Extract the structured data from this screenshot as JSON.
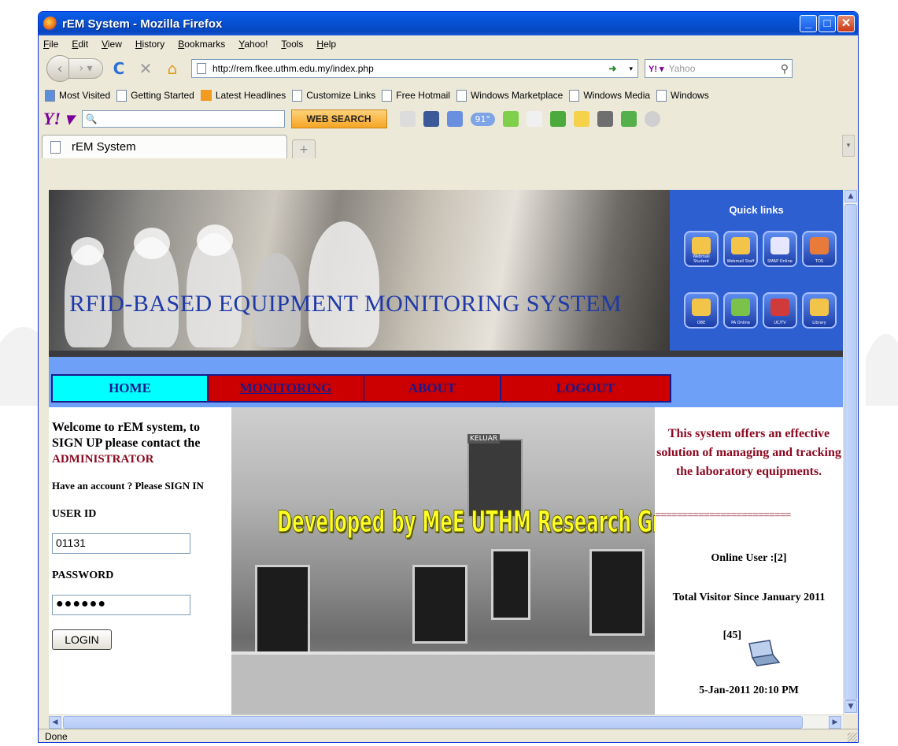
{
  "window": {
    "title": "rEM System - Mozilla Firefox"
  },
  "menubar": [
    "File",
    "Edit",
    "View",
    "History",
    "Bookmarks",
    "Yahoo!",
    "Tools",
    "Help"
  ],
  "navigation": {
    "url": "http://rem.fkee.uthm.edu.my/index.php",
    "search_placeholder": "Yahoo"
  },
  "bookmarks": [
    {
      "label": "Most Visited",
      "icon": "most-visited-icon"
    },
    {
      "label": "Getting Started",
      "icon": "page-icon"
    },
    {
      "label": "Latest Headlines",
      "icon": "rss-icon"
    },
    {
      "label": "Customize Links",
      "icon": "page-icon"
    },
    {
      "label": "Free Hotmail",
      "icon": "page-icon"
    },
    {
      "label": "Windows Marketplace",
      "icon": "page-icon"
    },
    {
      "label": "Windows Media",
      "icon": "page-icon"
    },
    {
      "label": "Windows",
      "icon": "page-icon"
    }
  ],
  "yahoo_toolbar": {
    "web_search_label": "WEB SEARCH",
    "weather": "91°"
  },
  "tab": {
    "label": "rEM System"
  },
  "page": {
    "banner_title": "RFID-BASED EQUIPMENT MONITORING SYSTEM",
    "quick_links": {
      "title": "Quick links",
      "items": [
        "Webmail Student",
        "Webmail Staff",
        "SMAP Online",
        "TOS",
        "OBE",
        "PA Online",
        "UC/TV",
        "Library"
      ]
    },
    "menu": {
      "home": "HOME",
      "monitoring": "MONITORING",
      "about": "ABOUT",
      "logout": "LOGOUT"
    },
    "login": {
      "welcome": "Welcome to rEM system, to SIGN UP please contact the",
      "admin": "ADMINISTRATOR",
      "have_account": "Have an account ? Please SIGN IN",
      "user_id_label": "USER ID",
      "user_id_value": "01131",
      "password_label": "PASSWORD",
      "password_value": "●●●●●●",
      "login_button": "LOGIN"
    },
    "photo_caption": "Developed by MeE UTHM Research Group",
    "photo_sign": "KELUAR",
    "info": {
      "offer": "This system offers an effective solution of managing and tracking the laboratory equipments.",
      "separator": "=========================",
      "online_user": "Online User :[2]",
      "total_visitor": "Total Visitor Since January 2011",
      "visitor_count": "[45]",
      "datetime": "5-Jan-2011 20:10 PM"
    }
  },
  "status": "Done",
  "colors": {
    "title_bar": "#0853d6",
    "nav_strip": "#6ea0f7",
    "home_tab": "#00ffff",
    "menu_tab": "#cc0000",
    "accent_text": "#8b0a22",
    "banner_title": "#1f3aa8",
    "slogan": "#ffff22"
  }
}
